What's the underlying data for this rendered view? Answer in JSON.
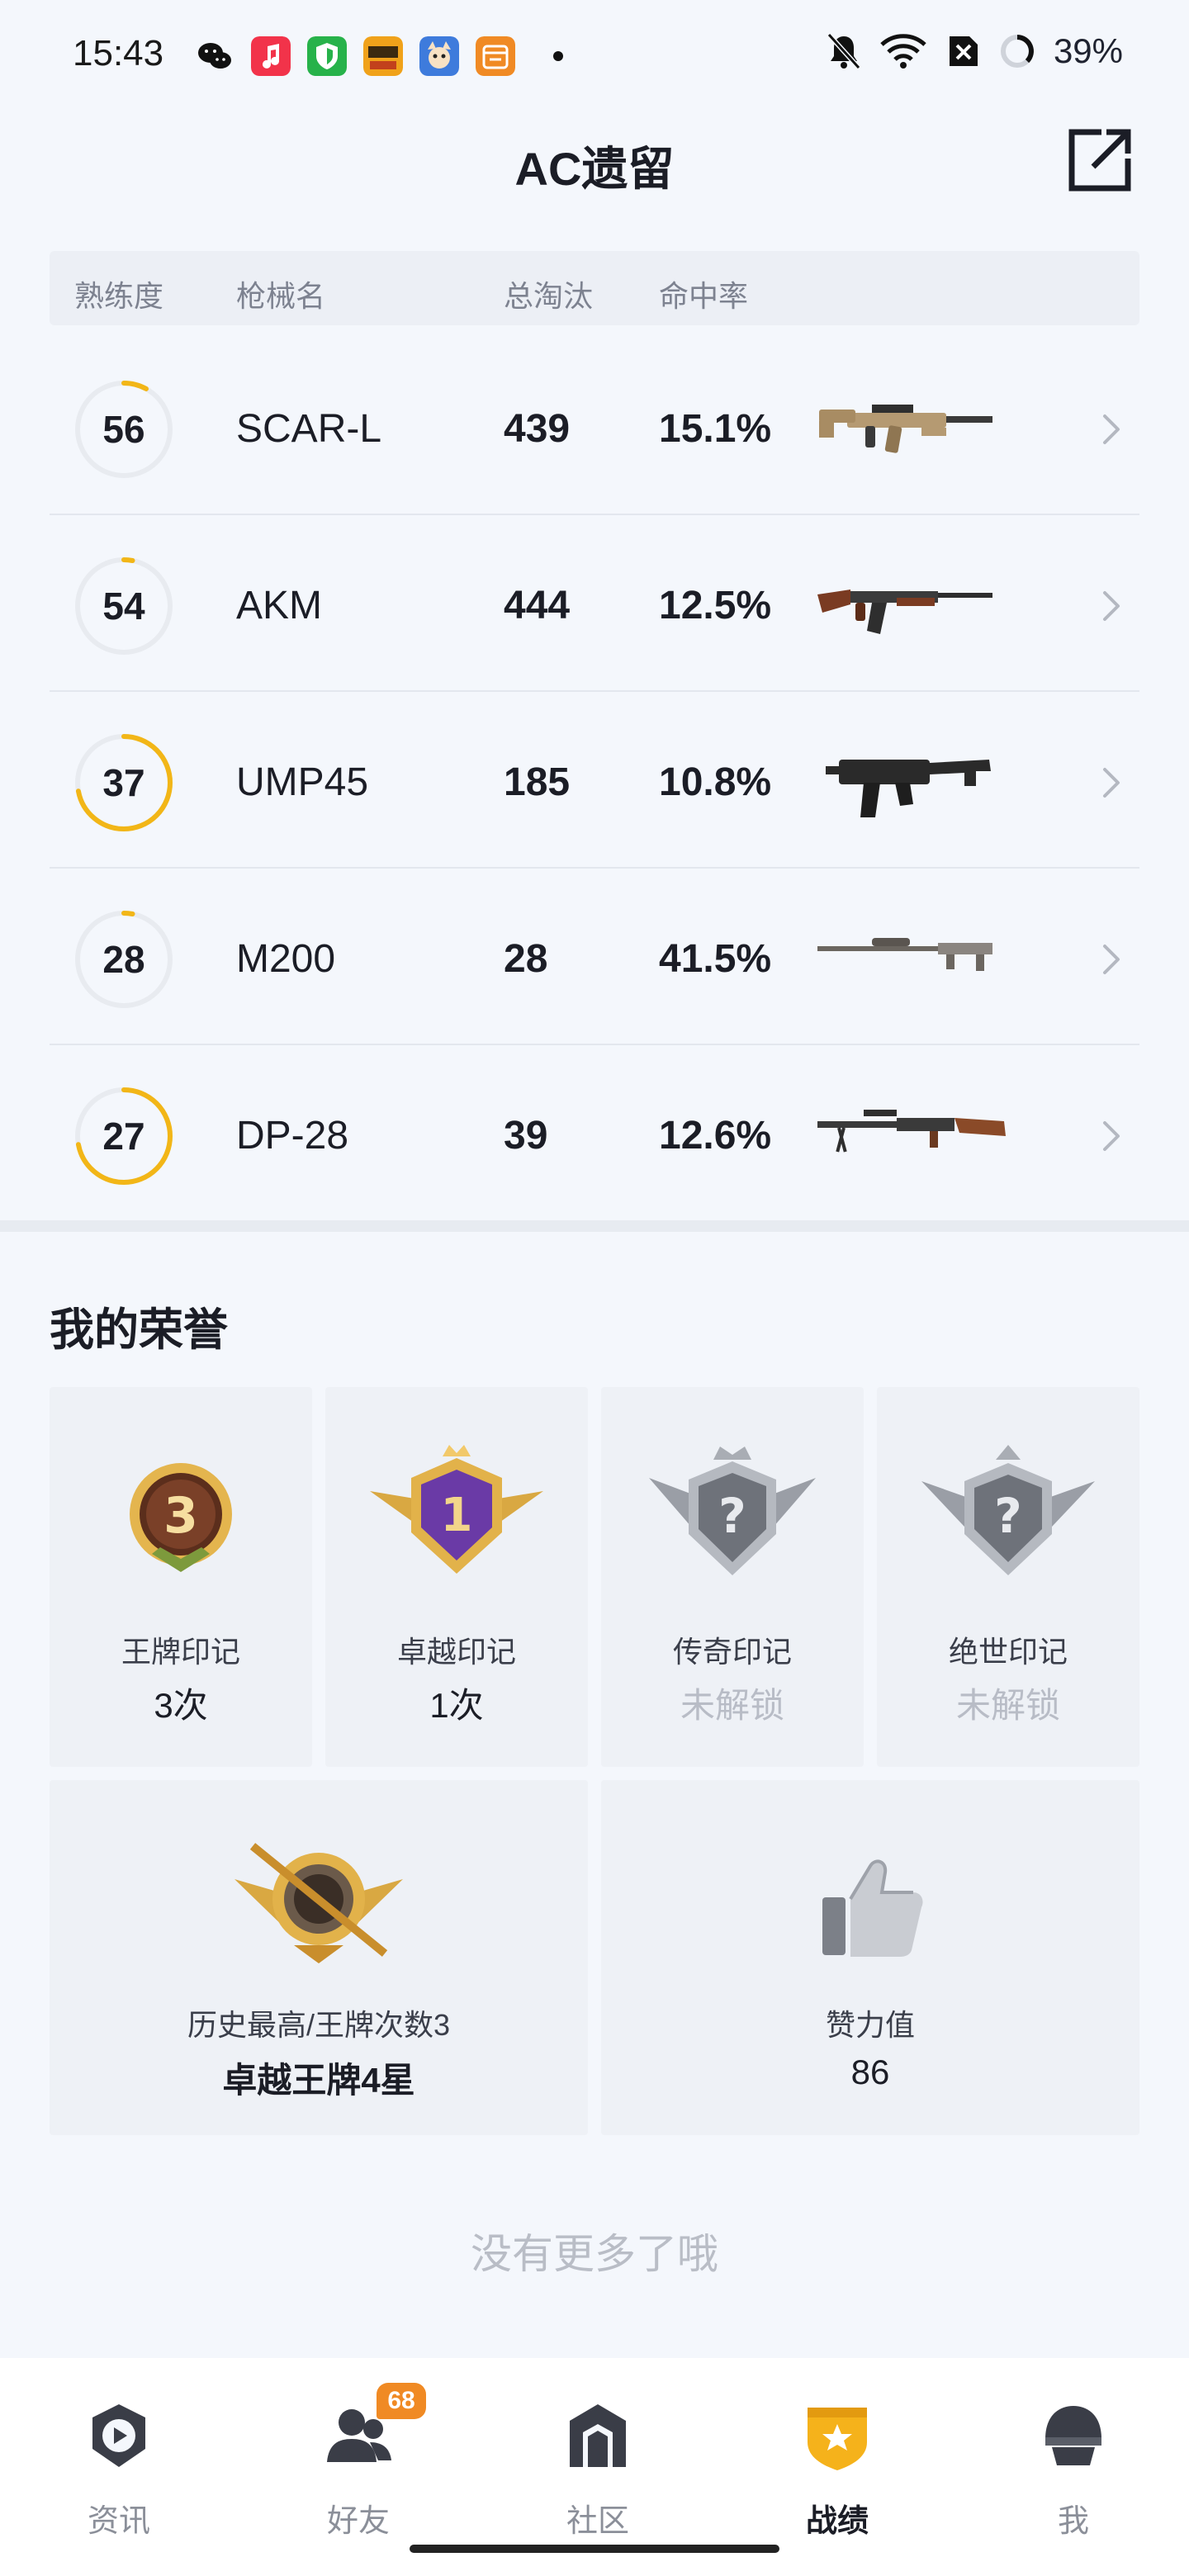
{
  "status_bar": {
    "time": "15:43",
    "battery": "39%",
    "icons": [
      "wechat-icon",
      "music-icon",
      "shield-app-icon",
      "game-app-icon",
      "game-app-2-icon",
      "calendar-app-icon",
      "notification-dot-icon",
      "bell-off-icon",
      "wifi-icon",
      "sim-off-icon",
      "battery-ring-icon"
    ]
  },
  "header": {
    "title": "AC遗留",
    "share_icon": "share-external-icon"
  },
  "table": {
    "headers": {
      "proficiency": "熟练度",
      "weapon": "枪械名",
      "kills": "总淘汰",
      "accuracy": "命中率"
    },
    "rows": [
      {
        "level": "56",
        "ring_fill": 0.08,
        "name": "SCAR-L",
        "kills": "439",
        "accuracy": "15.1%",
        "weapon_icon": "assault-rifle-tan"
      },
      {
        "level": "54",
        "ring_fill": 0.03,
        "name": "AKM",
        "kills": "444",
        "accuracy": "12.5%",
        "weapon_icon": "akm-rifle"
      },
      {
        "level": "37",
        "ring_fill": 0.72,
        "name": "UMP45",
        "kills": "185",
        "accuracy": "10.8%",
        "weapon_icon": "smg-black"
      },
      {
        "level": "28",
        "ring_fill": 0.03,
        "name": "M200",
        "kills": "28",
        "accuracy": "41.5%",
        "weapon_icon": "sniper-rifle"
      },
      {
        "level": "27",
        "ring_fill": 0.72,
        "name": "DP-28",
        "kills": "39",
        "accuracy": "12.6%",
        "weapon_icon": "light-machine-gun"
      }
    ]
  },
  "honors": {
    "title": "我的荣誉",
    "cards": [
      {
        "label": "王牌印记",
        "value": "3次",
        "locked": false,
        "badge_icon": "ace-badge-3-icon"
      },
      {
        "label": "卓越印记",
        "value": "1次",
        "locked": false,
        "badge_icon": "conqueror-badge-1-icon"
      },
      {
        "label": "传奇印记",
        "value": "未解锁",
        "locked": true,
        "badge_icon": "legend-badge-locked-icon"
      },
      {
        "label": "绝世印记",
        "value": "未解锁",
        "locked": true,
        "badge_icon": "peerless-badge-locked-icon"
      }
    ],
    "highest": {
      "label": "历史最高/王牌次数3",
      "value": "卓越王牌4星",
      "badge_icon": "rank-emblem-icon"
    },
    "likes": {
      "label": "赞力值",
      "value": "86",
      "badge_icon": "thumbs-up-icon"
    }
  },
  "footer_text": "没有更多了哦",
  "bottom_nav": [
    {
      "label": "资讯",
      "icon": "news-icon",
      "active": false,
      "badge": ""
    },
    {
      "label": "好友",
      "icon": "friends-icon",
      "active": false,
      "badge": "68"
    },
    {
      "label": "社区",
      "icon": "community-icon",
      "active": false,
      "badge": ""
    },
    {
      "label": "战绩",
      "icon": "record-icon",
      "active": true,
      "badge": ""
    },
    {
      "label": "我",
      "icon": "profile-helmet-icon",
      "active": false,
      "badge": ""
    }
  ],
  "colors": {
    "accent": "#f2b617",
    "background": "#f4f7fc",
    "badge_orange": "#f08a24"
  }
}
